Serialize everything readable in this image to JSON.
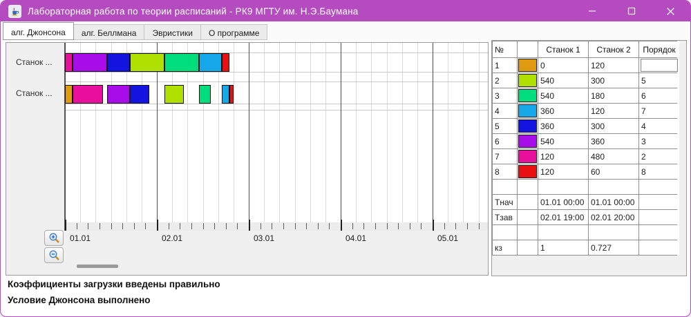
{
  "window": {
    "title": "Лабораторная работа по теории расписаний  -  РК9 МГТУ им. Н.Э.Баумана",
    "titlebar_color": "#b44bbf"
  },
  "tabs": [
    {
      "label": "алг. Джонсона",
      "active": true
    },
    {
      "label": "алг. Беллмана",
      "active": false
    },
    {
      "label": "Эвристики",
      "active": false
    },
    {
      "label": "О программе",
      "active": false
    }
  ],
  "gantt": {
    "machine_labels": [
      "Станок ...",
      "Станок ..."
    ],
    "axis": {
      "day_labels": [
        "01.01",
        "02.01",
        "03.01",
        "04.01",
        "05.01"
      ],
      "minutes_per_day": 1440,
      "grid_step_min": 240,
      "tick_step_min": 180
    },
    "rows": [
      {
        "segments": [
          {
            "color": "#e8109c",
            "start": 0,
            "end": 120
          },
          {
            "color": "#a80ce8",
            "start": 120,
            "end": 660
          },
          {
            "color": "#1414e0",
            "start": 660,
            "end": 1020
          },
          {
            "color": "#b0e000",
            "start": 1020,
            "end": 1560
          },
          {
            "color": "#00dd7d",
            "start": 1560,
            "end": 2100
          },
          {
            "color": "#16a8e8",
            "start": 2100,
            "end": 2460
          },
          {
            "color": "#e81010",
            "start": 2460,
            "end": 2580
          }
        ]
      },
      {
        "segments": [
          {
            "color": "#e09a10",
            "start": 0,
            "end": 120
          },
          {
            "color": "#e8109c",
            "start": 120,
            "end": 600
          },
          {
            "color": "#a80ce8",
            "start": 660,
            "end": 1020
          },
          {
            "color": "#1414e0",
            "start": 1020,
            "end": 1320
          },
          {
            "color": "#b0e000",
            "start": 1560,
            "end": 1860
          },
          {
            "color": "#00dd7d",
            "start": 2100,
            "end": 2280
          },
          {
            "color": "#16a8e8",
            "start": 2460,
            "end": 2580
          },
          {
            "color": "#e81010",
            "start": 2580,
            "end": 2640
          }
        ]
      }
    ],
    "zoom_in_label": "zoom-in",
    "zoom_out_label": "zoom-out"
  },
  "table": {
    "headers": [
      "№",
      "",
      "Станок 1",
      "Станок 2",
      "Порядок"
    ],
    "rows": [
      {
        "num": "1",
        "color": "#e09a10",
        "m1": "0",
        "m2": "120",
        "order": "",
        "editor": true
      },
      {
        "num": "2",
        "color": "#b0e000",
        "m1": "540",
        "m2": "300",
        "order": "5"
      },
      {
        "num": "3",
        "color": "#00dd7d",
        "m1": "540",
        "m2": "180",
        "order": "6"
      },
      {
        "num": "4",
        "color": "#16a8e8",
        "m1": "360",
        "m2": "120",
        "order": "7"
      },
      {
        "num": "5",
        "color": "#1414e0",
        "m1": "360",
        "m2": "300",
        "order": "4"
      },
      {
        "num": "6",
        "color": "#a80ce8",
        "m1": "540",
        "m2": "360",
        "order": "3"
      },
      {
        "num": "7",
        "color": "#e8109c",
        "m1": "120",
        "m2": "480",
        "order": "2"
      },
      {
        "num": "8",
        "color": "#e81010",
        "m1": "120",
        "m2": "60",
        "order": "8"
      },
      {
        "num": "",
        "color": null,
        "m1": "",
        "m2": "",
        "order": ""
      },
      {
        "num": "Тнач",
        "color": null,
        "m1": "01.01 00:00",
        "m2": "01.01 00:00",
        "order": ""
      },
      {
        "num": "Тзав",
        "color": null,
        "m1": "02.01 19:00",
        "m2": "02.01 20:00",
        "order": ""
      },
      {
        "num": "",
        "color": null,
        "m1": "",
        "m2": "",
        "order": ""
      },
      {
        "num": "кз",
        "color": null,
        "m1": "1",
        "m2": "0.727",
        "order": ""
      }
    ]
  },
  "status_lines": [
    "Коэффициенты загрузки введены правильно",
    "Условие Джонсона выполнено"
  ]
}
